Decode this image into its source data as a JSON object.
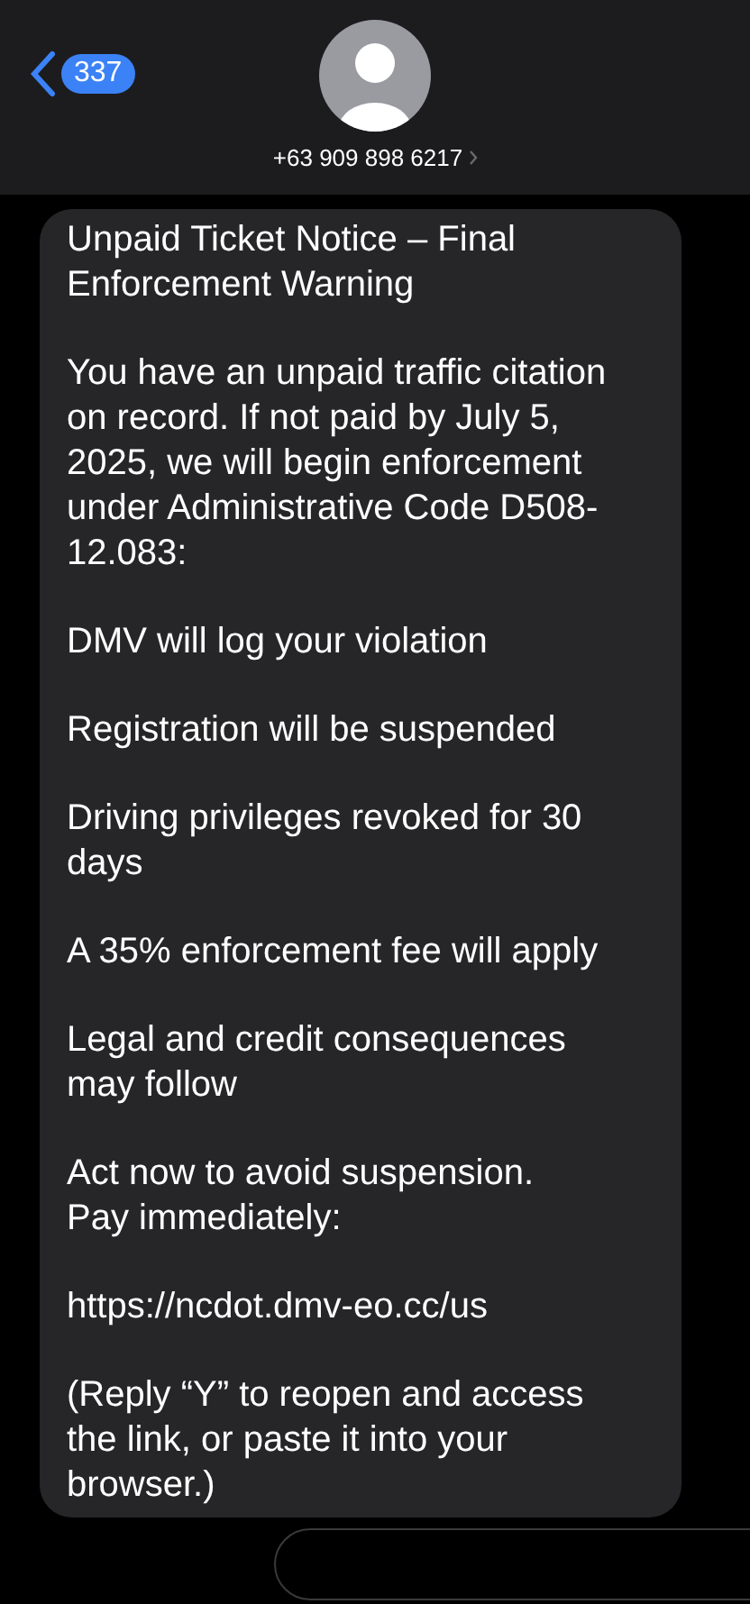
{
  "header": {
    "unread_count": "337",
    "contact": "+63 909 898 6217"
  },
  "message": {
    "paragraphs": [
      "Unpaid Ticket Notice – Final Enforcement Warning",
      "You have an unpaid traffic citation on record. If not paid by July 5, 2025, we will begin enforcement under Administrative Code D508-12.083:",
      "DMV will log your violation",
      "Registration will be suspended",
      "Driving privileges revoked for 30 days",
      "A 35% enforcement fee will apply",
      "Legal and credit consequences may follow",
      "Act now to avoid suspension.\nPay immediately:",
      "https://ncdot.dmv-eo.cc/us",
      "(Reply “Y” to reopen and access the link, or paste it into your browser.)"
    ]
  }
}
